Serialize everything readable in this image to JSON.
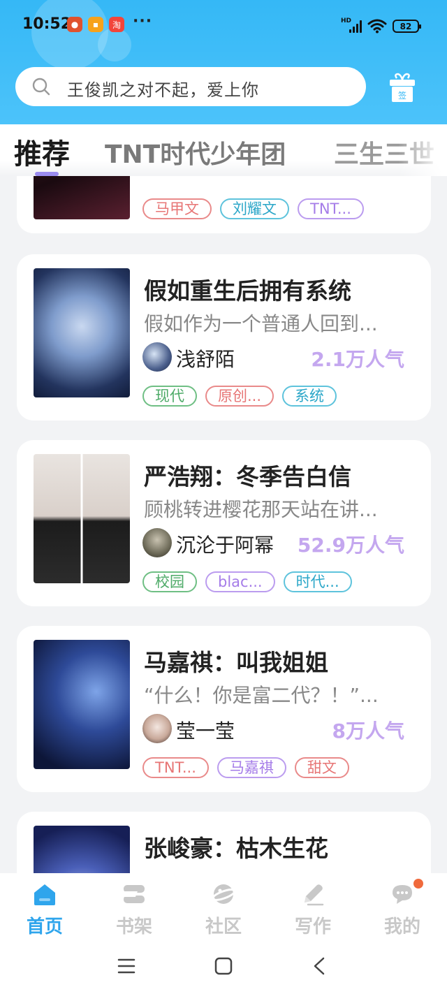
{
  "status_bar": {
    "time": "10:52",
    "more": "···",
    "network": "HD",
    "battery": "82"
  },
  "search": {
    "placeholder": "王俊凯之对不起，爱上你",
    "gift_label": "签"
  },
  "tabs": [
    "推荐",
    "TNT时代少年团",
    "三生三世"
  ],
  "books": [
    {
      "title": "",
      "description": "",
      "author": "",
      "popularity": "",
      "tags": [
        {
          "label": "马甲文",
          "color": "red"
        },
        {
          "label": "刘耀文",
          "color": "cyan"
        },
        {
          "label": "TNT...",
          "color": "purple"
        }
      ]
    },
    {
      "title": "假如重生后拥有系统",
      "description": "假如作为一个普通人回到...",
      "author": "浅舒陌",
      "popularity": "2.1万人气",
      "tags": [
        {
          "label": "现代",
          "color": "green"
        },
        {
          "label": "原创...",
          "color": "red"
        },
        {
          "label": "系统",
          "color": "cyan"
        }
      ]
    },
    {
      "title": "严浩翔：冬季告白信",
      "description": "顾桃转进樱花那天站在讲...",
      "author": "沉沦于阿幂",
      "popularity": "52.9万人气",
      "tags": [
        {
          "label": "校园",
          "color": "green"
        },
        {
          "label": "blac...",
          "color": "purple"
        },
        {
          "label": "时代...",
          "color": "cyan"
        }
      ]
    },
    {
      "title": "马嘉祺：叫我姐姐",
      "description": "“什么！你是富二代？！”...",
      "author": "莹一莹",
      "popularity": "8万人气",
      "tags": [
        {
          "label": "TNT...",
          "color": "red"
        },
        {
          "label": "马嘉祺",
          "color": "purple"
        },
        {
          "label": "甜文",
          "color": "red"
        }
      ]
    },
    {
      "title": "张峻豪：枯木生花",
      "description": "",
      "author": "",
      "popularity": "",
      "tags": []
    }
  ],
  "bottom_nav": [
    {
      "label": "首页",
      "icon": "home-icon",
      "active": true
    },
    {
      "label": "书架",
      "icon": "bookshelf-icon",
      "active": false
    },
    {
      "label": "社区",
      "icon": "planet-icon",
      "active": false
    },
    {
      "label": "写作",
      "icon": "pencil-icon",
      "active": false
    },
    {
      "label": "我的",
      "icon": "chat-bubble-icon",
      "active": false
    }
  ],
  "colors": {
    "header": "#35b8f6",
    "accent": "#2fa5ec",
    "popularity": "#c4a7ef",
    "tab_indicator": "#9b8cf0"
  }
}
